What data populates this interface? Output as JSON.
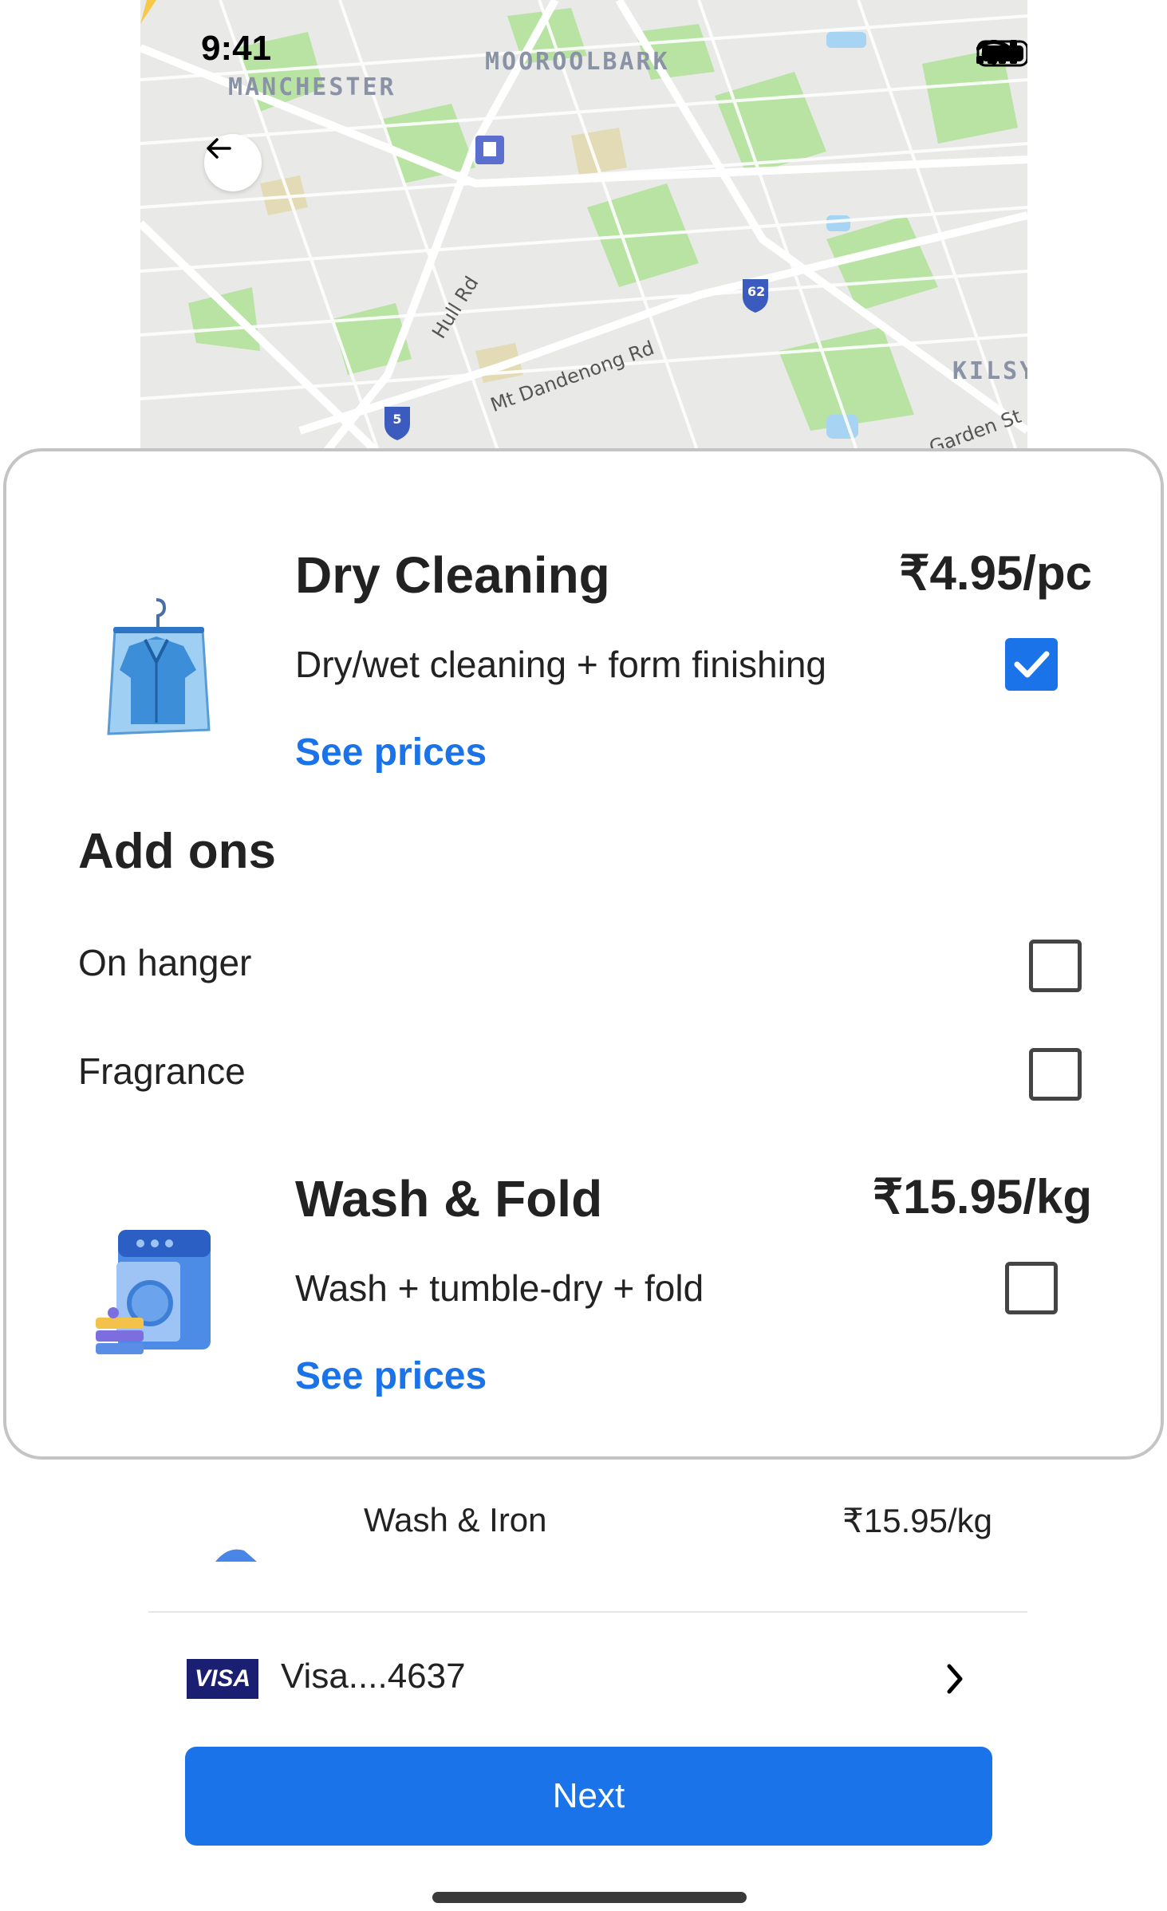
{
  "status_bar": {
    "time": "9:41"
  },
  "map": {
    "labels": [
      "MANCHESTER",
      "MOOROOLBARK",
      "KILSY"
    ],
    "roads": [
      "Hull Rd",
      "Mt Dandenong Rd",
      "Garden St"
    ],
    "route_badges": [
      "62",
      "5"
    ]
  },
  "services": [
    {
      "title": "Dry Cleaning",
      "price": "₹4.95/pc",
      "description": "Dry/wet cleaning + form finishing",
      "link": "See prices",
      "checked": true,
      "icon": "dry-cleaning-shirt-icon"
    },
    {
      "title": "Wash & Fold",
      "price": "₹15.95/kg",
      "description": "Wash + tumble-dry + fold",
      "link": "See prices",
      "checked": false,
      "icon": "washing-machine-icon"
    }
  ],
  "addons": {
    "title": "Add ons",
    "items": [
      {
        "label": "On hanger",
        "checked": false
      },
      {
        "label": "Fragrance",
        "checked": false
      }
    ]
  },
  "wash_iron": {
    "title": "Wash & Iron",
    "price": "₹15.95/kg"
  },
  "payment": {
    "brand": "VISA",
    "label": "Visa....4637"
  },
  "next_button": "Next",
  "colors": {
    "primary": "#1a73e8",
    "visa": "#1a1f71",
    "map_bg": "#e8e8e6",
    "park": "#a8dc8f"
  }
}
